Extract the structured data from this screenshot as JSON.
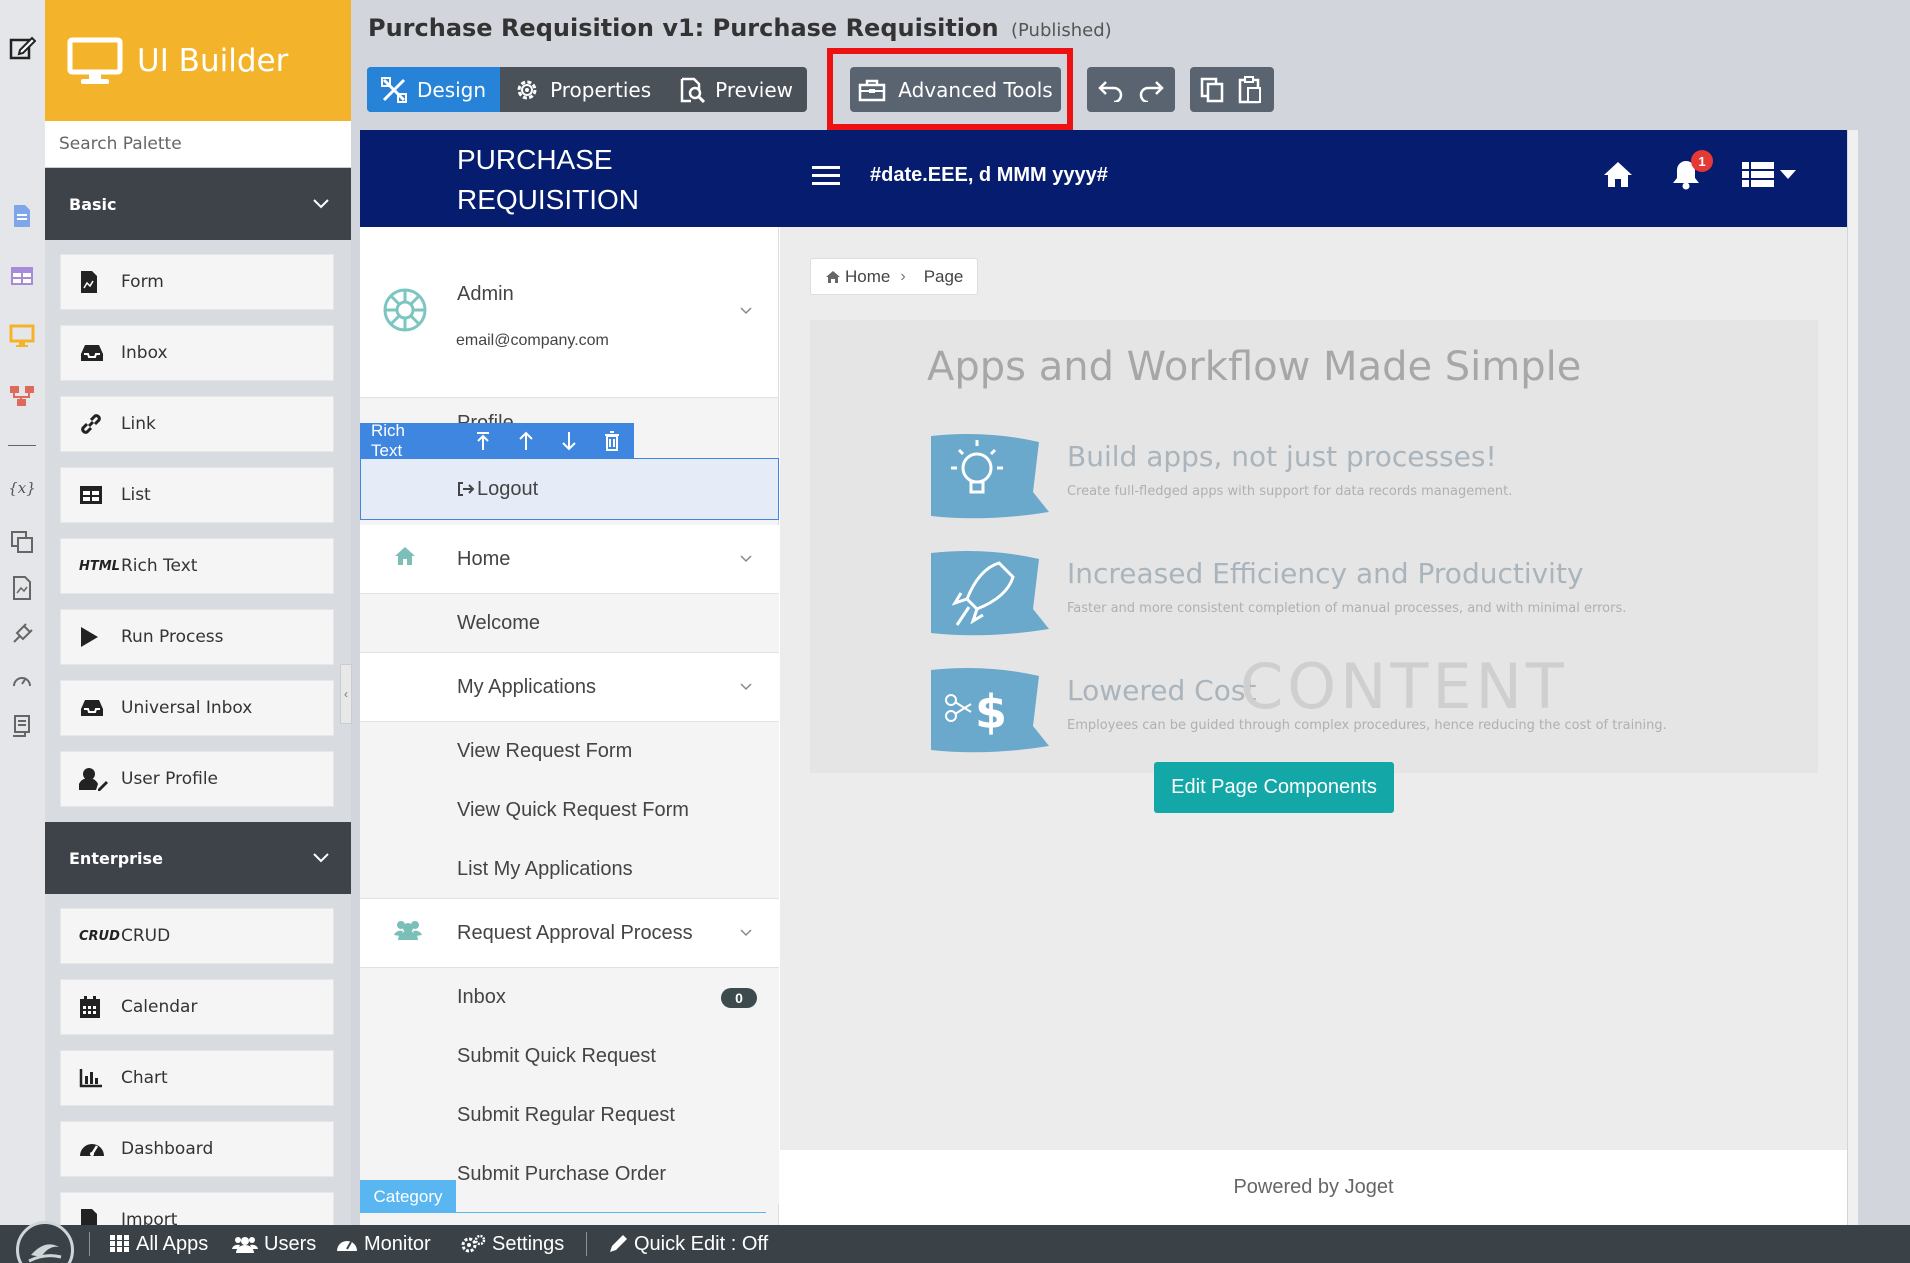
{
  "app": {
    "logo_text": "UI Builder",
    "title": "Purchase Requisition v1: Purchase Requisition",
    "status": "(Published)"
  },
  "toolbar": {
    "tabs": [
      {
        "label": "Design",
        "icon": "design-icon",
        "active": true
      },
      {
        "label": "Properties",
        "icon": "gear-icon",
        "active": false
      },
      {
        "label": "Preview",
        "icon": "preview-icon",
        "active": false
      }
    ],
    "advanced_tools": "Advanced Tools",
    "highlight_color": "#ee1111"
  },
  "palette": {
    "search_placeholder": "Search Palette",
    "basic": {
      "label": "Basic",
      "items": [
        {
          "label": "Form",
          "icon": "form-icon"
        },
        {
          "label": "Inbox",
          "icon": "inbox-icon"
        },
        {
          "label": "Link",
          "icon": "link-icon"
        },
        {
          "label": "List",
          "icon": "list-icon"
        },
        {
          "label": "Rich Text",
          "icon": "html-icon",
          "icon_text": "HTML"
        },
        {
          "label": "Run Process",
          "icon": "play-icon"
        },
        {
          "label": "Universal Inbox",
          "icon": "inbox-icon"
        },
        {
          "label": "User Profile",
          "icon": "user-edit-icon"
        }
      ]
    },
    "enterprise": {
      "label": "Enterprise",
      "items": [
        {
          "label": "CRUD",
          "icon": "crud-icon",
          "icon_text": "CRUD"
        },
        {
          "label": "Calendar",
          "icon": "calendar-icon"
        },
        {
          "label": "Chart",
          "icon": "chart-icon"
        },
        {
          "label": "Dashboard",
          "icon": "dashboard-icon"
        },
        {
          "label": "Import",
          "icon": "import-icon"
        }
      ]
    }
  },
  "canvas": {
    "brand_line1": "PURCHASE",
    "brand_line2": "REQUISITION",
    "date_format": "#date.EEE, d MMM yyyy#",
    "notification_count": "1",
    "navbar_color": "#051c6f",
    "profile": {
      "name": "Admin",
      "email": "email@company.com",
      "partial_label": "Profile"
    },
    "rich_text_toolbar": {
      "label": "Rich Text"
    },
    "selected_item": "Logout",
    "menu": [
      {
        "label": "Home",
        "type": "group",
        "icon": "home-icon"
      },
      {
        "label": "Welcome",
        "type": "sub"
      },
      {
        "label": "My Applications",
        "type": "group"
      },
      {
        "label": "View Request Form",
        "type": "sub"
      },
      {
        "label": "View Quick Request Form",
        "type": "sub"
      },
      {
        "label": "List My Applications",
        "type": "sub"
      },
      {
        "label": "Request Approval Process",
        "type": "group",
        "icon": "users-icon"
      },
      {
        "label": "Inbox",
        "type": "sub",
        "count": "0"
      },
      {
        "label": "Submit Quick Request",
        "type": "sub"
      },
      {
        "label": "Submit Regular Request",
        "type": "sub"
      },
      {
        "label": "Submit Purchase Order",
        "type": "sub"
      }
    ],
    "category_badge": "Category",
    "breadcrumb": {
      "home": "Home",
      "page": "Page"
    },
    "hero": {
      "title": "Apps and Workflow Made Simple",
      "features": [
        {
          "title": "Build apps, not just processes!",
          "desc": "Create full-fledged apps with support for data records management.",
          "icon": "lightbulb-icon"
        },
        {
          "title": "Increased Efficiency and Productivity",
          "desc": "Faster and more consistent completion of manual processes, and with minimal errors.",
          "icon": "rocket-icon"
        },
        {
          "title": "Lowered Cost",
          "desc": "Employees can be guided through complex procedures, hence reducing the cost of training.",
          "icon": "dollar-cut-icon"
        }
      ],
      "watermark": "CONTENT"
    },
    "edit_button": "Edit Page Components",
    "footer": "Powered by Joget"
  },
  "bottombar": {
    "items": [
      {
        "label": "All Apps",
        "icon": "grid-icon"
      },
      {
        "label": "Users",
        "icon": "users-icon"
      },
      {
        "label": "Monitor",
        "icon": "dashboard-icon"
      },
      {
        "label": "Settings",
        "icon": "cogs-icon"
      },
      {
        "label": "Quick Edit : Off",
        "icon": "pencil-icon"
      }
    ]
  }
}
